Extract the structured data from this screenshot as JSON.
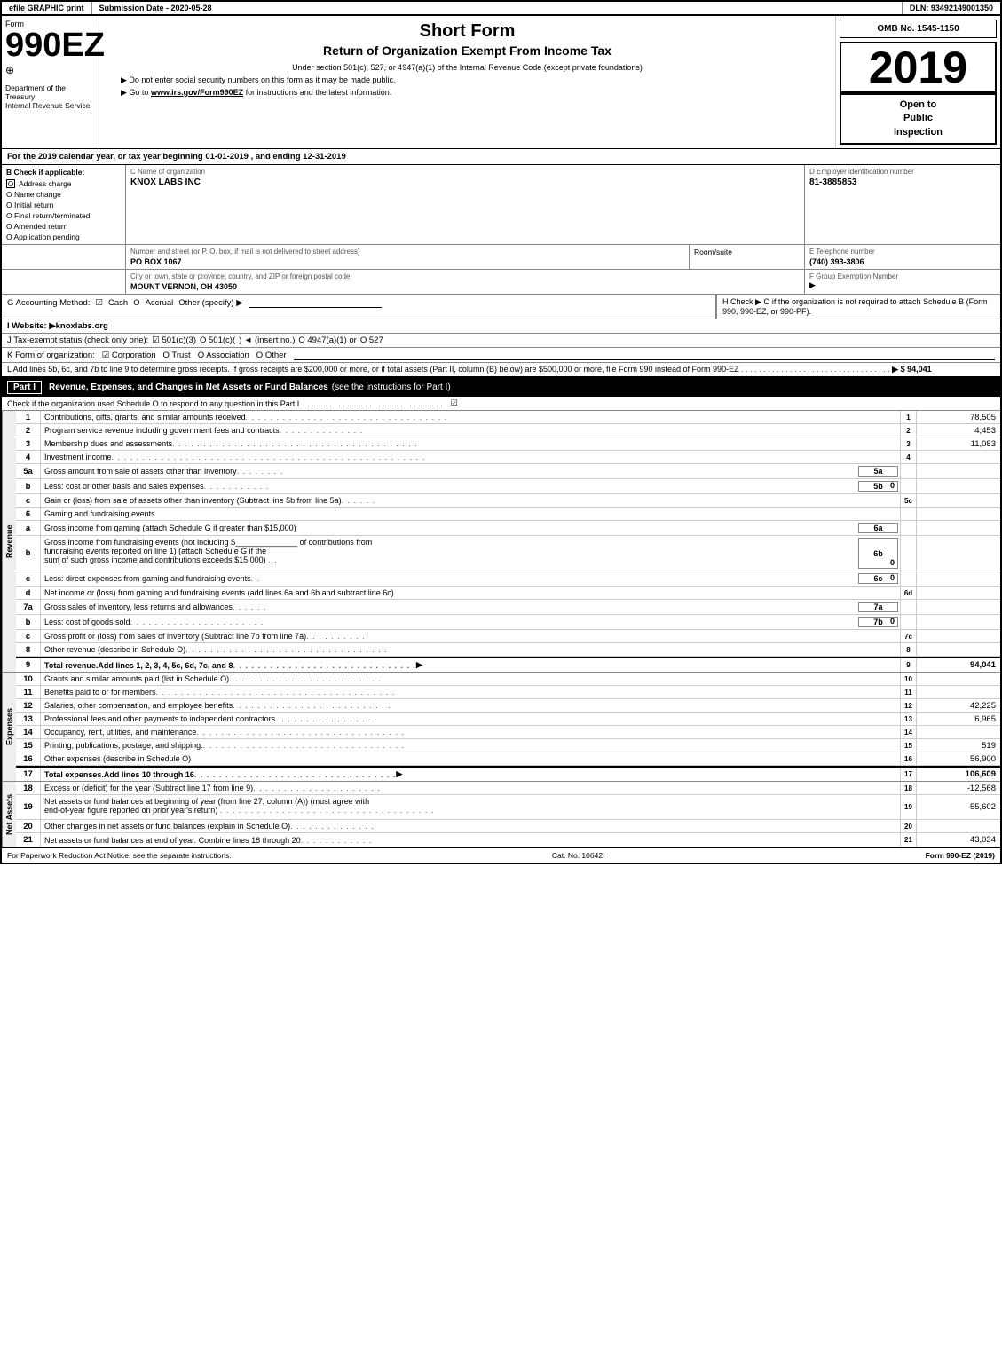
{
  "header": {
    "efile_label": "efile GRAPHIC print",
    "submission_label": "Submission Date - 2020-05-28",
    "dln_label": "DLN: 93492149001350",
    "form_number": "Form",
    "form_990ez": "990EZ",
    "form_symbol": "⊕",
    "short_form_title": "Short Form",
    "return_title": "Return of Organization Exempt From Income Tax",
    "under_section": "Under section 501(c), 527, or 4947(a)(1) of the Internal Revenue Code (except private foundations)",
    "no_ssn": "▶ Do not enter social security numbers on this form as it may be made public.",
    "go_to": "▶ Go to",
    "irs_url": "www.irs.gov/Form990EZ",
    "for_instructions": "for instructions and the latest information.",
    "omb_no": "OMB No. 1545-1150",
    "year": "2019",
    "open_to_public": "Open to",
    "public": "Public",
    "inspection": "Inspection",
    "dept_treasury": "Department of the Treasury",
    "internal_revenue": "Internal Revenue Service"
  },
  "tax_year_line": "For the 2019 calendar year, or tax year beginning 01-01-2019 , and ending 12-31-2019",
  "check_if_applicable": "B Check if applicable:",
  "checkboxes": {
    "address_change": "Address charge",
    "name_change": "O Name change",
    "initial_return": "O Initial return",
    "final_return": "O Final return/terminated",
    "amended_return": "O Amended return",
    "application_pending": "O Application pending"
  },
  "org_name_label": "C Name of organization",
  "org_name": "KNOX LABS INC",
  "address_label": "Number and street (or P. O. box, if mail is not delivered to street address)",
  "address_value": "PO BOX 1067",
  "room_suite_label": "Room/suite",
  "city_label": "City or town, state or province, country, and ZIP or foreign postal code",
  "city_value": "MOUNT VERNON, OH  43050",
  "ein_label": "D Employer identification number",
  "ein_value": "81-3885853",
  "telephone_label": "E Telephone number",
  "telephone_value": "(740) 393-3806",
  "group_exempt_label": "F Group Exemption Number",
  "group_exempt_arrow": "▶",
  "accounting_label": "G Accounting Method:",
  "accounting_cash_cb": "☑",
  "accounting_cash": "Cash",
  "accounting_accrual_cb": "O",
  "accounting_accrual": "Accrual",
  "accounting_other": "Other (specify) ▶",
  "h_check": "H  Check ▶  O if the organization is not required to attach Schedule B (Form 990, 990-EZ, or 990-PF).",
  "website_label": "I Website: ▶knoxlabs.org",
  "tax_exempt_label": "J Tax-exempt status (check only one):",
  "tax_exempt_501c3": "☑ 501(c)(3)",
  "tax_exempt_501c": "O 501(c)(",
  "tax_exempt_insert": " ) ◄ (insert no.)",
  "tax_exempt_4947": "O 4947(a)(1) or",
  "tax_exempt_527": "O 527",
  "form_org_label": "K Form of organization:",
  "form_org_corp": "☑ Corporation",
  "form_org_trust": "O Trust",
  "form_org_assoc": "O Association",
  "form_org_other": "O Other",
  "line_l": "L Add lines 5b, 6c, and 7b to line 9 to determine gross receipts. If gross receipts are $200,000 or more, or if total assets (Part II, column (B) below) are $500,000 or more, file Form 990 instead of Form 990-EZ",
  "line_l_dots": ". . . . . . . . . . . . . . . . . . . . . . . . . . . . . . . . . .",
  "line_l_arrow": "▶ $ 94,041",
  "part_i_label": "Part I",
  "part_i_title": "Revenue, Expenses, and Changes in Net Assets or Fund Balances",
  "part_i_see": "(see the instructions for Part I)",
  "schedule_o_check": "Check if the organization used Schedule O to respond to any question in this Part I",
  "schedule_o_dots": ". . . . . . . . . . . . . . . . . . . . . . . . . . . . . . . . .",
  "schedule_o_checkbox": "☑",
  "revenue_label": "Revenue",
  "expenses_label": "Expenses",
  "net_assets_label": "Net Assets",
  "rows": [
    {
      "num": "1",
      "label": "Contributions, gifts, grants, and similar amounts received",
      "dots": true,
      "line_num": "1",
      "value": "78,505"
    },
    {
      "num": "2",
      "label": "Program service revenue including government fees and contracts",
      "dots": true,
      "line_num": "2",
      "value": "4,453"
    },
    {
      "num": "3",
      "label": "Membership dues and assessments",
      "dots": true,
      "line_num": "3",
      "value": "11,083"
    },
    {
      "num": "4",
      "label": "Investment income",
      "dots": true,
      "line_num": "4",
      "value": ""
    },
    {
      "num": "5a",
      "label": "Gross amount from sale of assets other than inventory",
      "dots": false,
      "sub_box": "5a",
      "line_num": "",
      "value": ""
    },
    {
      "num": "b",
      "label": "Less: cost or other basis and sales expenses",
      "dots": false,
      "sub_box": "5b",
      "sub_value": "0",
      "line_num": "",
      "value": ""
    },
    {
      "num": "c",
      "label": "Gain or (loss) from sale of assets other than inventory (Subtract line 5b from line 5a)",
      "dots": false,
      "line_num": "5c",
      "value": ""
    },
    {
      "num": "6",
      "label": "Gaming and fundraising events",
      "dots": false,
      "line_num": "",
      "value": ""
    },
    {
      "num": "a",
      "label": "Gross income from gaming (attach Schedule G if greater than $15,000)",
      "dots": false,
      "sub_box": "6a",
      "line_num": "",
      "value": ""
    },
    {
      "num": "b",
      "label": "Gross income from fundraising events (not including $________________ of contributions from fundraising events reported on line 1) (attach Schedule G if the sum of such gross income and contributions exceeds $15,000)",
      "dots": false,
      "sub_box": "6b",
      "sub_value": "0",
      "line_num": "",
      "value": ""
    },
    {
      "num": "c",
      "label": "Less: direct expenses from gaming and fundraising events",
      "dots": false,
      "sub_box": "6c",
      "sub_value": "0",
      "line_num": "",
      "value": ""
    },
    {
      "num": "d",
      "label": "Net income or (loss) from gaming and fundraising events (add lines 6a and 6b and subtract line 6c)",
      "dots": false,
      "line_num": "6d",
      "value": ""
    },
    {
      "num": "7a",
      "label": "Gross sales of inventory, less returns and allowances",
      "dots": false,
      "sub_box": "7a",
      "line_num": "",
      "value": ""
    },
    {
      "num": "b",
      "label": "Less: cost of goods sold",
      "dots": false,
      "sub_box": "7b",
      "sub_value": "0",
      "line_num": "",
      "value": ""
    },
    {
      "num": "c",
      "label": "Gross profit or (loss) from sales of inventory (Subtract line 7b from line 7a)",
      "dots": false,
      "line_num": "7c",
      "value": ""
    },
    {
      "num": "8",
      "label": "Other revenue (describe in Schedule O)",
      "dots": false,
      "line_num": "8",
      "value": ""
    },
    {
      "num": "9",
      "label": "Total revenue. Add lines 1, 2, 3, 4, 5c, 6d, 7c, and 8",
      "dots": false,
      "line_num": "9",
      "value": "94,041",
      "bold": true,
      "arrow": true
    }
  ],
  "expense_rows": [
    {
      "num": "10",
      "label": "Grants and similar amounts paid (list in Schedule O)",
      "dots": true,
      "line_num": "10",
      "value": ""
    },
    {
      "num": "11",
      "label": "Benefits paid to or for members",
      "dots": true,
      "line_num": "11",
      "value": ""
    },
    {
      "num": "12",
      "label": "Salaries, other compensation, and employee benefits",
      "dots": true,
      "line_num": "12",
      "value": "42,225"
    },
    {
      "num": "13",
      "label": "Professional fees and other payments to independent contractors",
      "dots": true,
      "line_num": "13",
      "value": "6,965"
    },
    {
      "num": "14",
      "label": "Occupancy, rent, utilities, and maintenance",
      "dots": true,
      "line_num": "14",
      "value": ""
    },
    {
      "num": "15",
      "label": "Printing, publications, postage, and shipping.",
      "dots": true,
      "line_num": "15",
      "value": "519"
    },
    {
      "num": "16",
      "label": "Other expenses (describe in Schedule O)",
      "dots": false,
      "line_num": "16",
      "value": "56,900"
    },
    {
      "num": "17",
      "label": "Total expenses. Add lines 10 through 16",
      "dots": true,
      "line_num": "17",
      "value": "106,609",
      "bold": true,
      "arrow": true
    }
  ],
  "assets_rows": [
    {
      "num": "18",
      "label": "Excess or (deficit) for the year (Subtract line 17 from line 9)",
      "dots": true,
      "line_num": "18",
      "value": "-12,568"
    },
    {
      "num": "19",
      "label": "Net assets or fund balances at beginning of year (from line 27, column (A)) (must agree with end-of-year figure reported on prior year's return)",
      "dots": true,
      "line_num": "19",
      "value": "55,602"
    },
    {
      "num": "20",
      "label": "Other changes in net assets or fund balances (explain in Schedule O)",
      "dots": true,
      "line_num": "20",
      "value": ""
    },
    {
      "num": "21",
      "label": "Net assets or fund balances at end of year. Combine lines 18 through 20",
      "dots": true,
      "line_num": "21",
      "value": "43,034"
    }
  ],
  "footer": {
    "paperwork_notice": "For Paperwork Reduction Act Notice, see the separate instructions.",
    "cat_no": "Cat. No. 10642I",
    "form_label": "Form 990-EZ (2019)"
  }
}
